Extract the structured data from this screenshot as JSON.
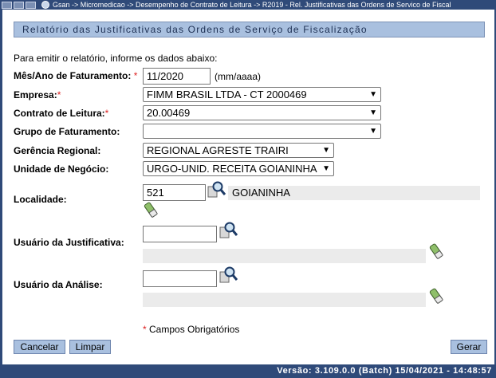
{
  "breadcrumb": "Gsan -> Micromedicao -> Desempenho de Contrato de Leitura -> R2019 - Rel. Justificativas das Ordens de Servico de Fiscal",
  "panel_title": "Relatório das Justificativas das Ordens de Serviço de Fiscalização",
  "intro": "Para emitir o relatório, informe os dados abaixo:",
  "required_mark": "*",
  "fields": {
    "mes_ano": {
      "label": "Mês/Ano de Faturamento:",
      "value": "11/2020",
      "hint": "(mm/aaaa)"
    },
    "empresa": {
      "label": "Empresa:",
      "value": "FIMM BRASIL LTDA - CT 2000469"
    },
    "contrato": {
      "label": "Contrato de Leitura:",
      "value": "20.00469"
    },
    "grupo": {
      "label": "Grupo de Faturamento:",
      "value": ""
    },
    "gerencia": {
      "label": "Gerência Regional:",
      "value": "REGIONAL AGRESTE TRAIRI"
    },
    "unidade": {
      "label": "Unidade de Negócio:",
      "value": "URGO-UNID. RECEITA GOIANINHA"
    },
    "localidade": {
      "label": "Localidade:",
      "code": "521",
      "name": "GOIANINHA"
    },
    "usuario_justificativa": {
      "label": "Usuário da Justificativa:",
      "value": "",
      "name": ""
    },
    "usuario_analise": {
      "label": "Usuário da Análise:",
      "value": "",
      "name": ""
    }
  },
  "required_note": "Campos Obrigatórios",
  "buttons": {
    "cancel": "Cancelar",
    "clear": "Limpar",
    "generate": "Gerar"
  },
  "version": "Versão: 3.109.0.0 (Batch) 15/04/2021 - 14:48:57",
  "icons": {
    "lookup": "magnifier-icon",
    "clear": "eraser-icon",
    "home": "home-icon"
  }
}
